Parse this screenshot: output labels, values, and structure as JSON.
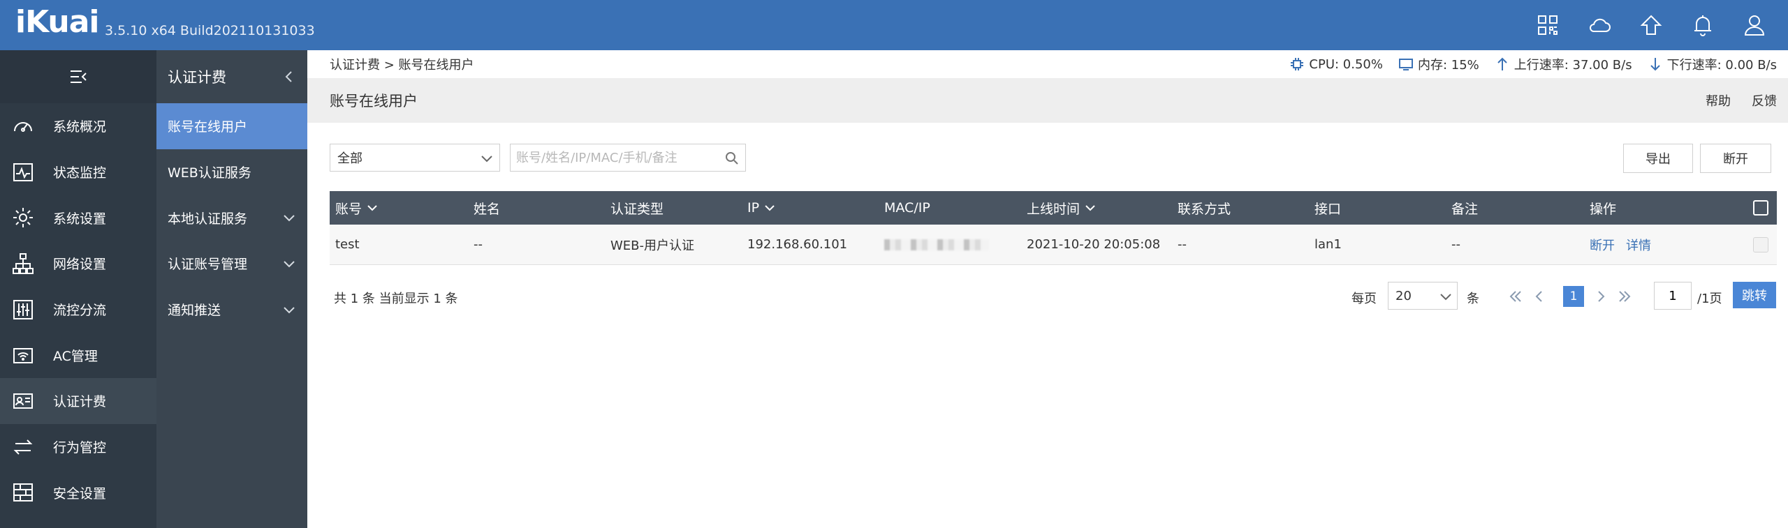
{
  "header": {
    "logo": "iKuai",
    "version": "3.5.10 x64 Build202110131033",
    "icons": [
      "apps-grid-icon",
      "cloud-icon",
      "home-arrow-icon",
      "bell-icon",
      "user-icon"
    ]
  },
  "leftnav": {
    "items": [
      {
        "label": "系统概况",
        "icon": "speedometer-icon"
      },
      {
        "label": "状态监控",
        "icon": "pulse-icon"
      },
      {
        "label": "系统设置",
        "icon": "gear-icon"
      },
      {
        "label": "网络设置",
        "icon": "network-icon"
      },
      {
        "label": "流控分流",
        "icon": "sliders-icon"
      },
      {
        "label": "AC管理",
        "icon": "wifi-icon"
      },
      {
        "label": "认证计费",
        "icon": "id-card-icon"
      },
      {
        "label": "行为管控",
        "icon": "swap-icon"
      },
      {
        "label": "安全设置",
        "icon": "firewall-icon"
      }
    ],
    "active_index": 6
  },
  "subnav": {
    "title": "认证计费",
    "items": [
      {
        "label": "账号在线用户",
        "expandable": false
      },
      {
        "label": "WEB认证服务",
        "expandable": false
      },
      {
        "label": "本地认证服务",
        "expandable": true
      },
      {
        "label": "认证账号管理",
        "expandable": true
      },
      {
        "label": "通知推送",
        "expandable": true
      }
    ]
  },
  "breadcrumb": {
    "text": "认证计费 > 账号在线用户"
  },
  "stats": {
    "cpu": "CPU: 0.50%",
    "memory": "内存: 15%",
    "upload": "上行速率: 37.00 B/s",
    "download": "下行速率: 0.00 B/s"
  },
  "page": {
    "title": "账号在线用户",
    "help": "帮助",
    "feedback": "反馈"
  },
  "toolbar": {
    "filter_value": "全部",
    "search_placeholder": "账号/姓名/IP/MAC/手机/备注",
    "export_label": "导出",
    "disconnect_label": "断开"
  },
  "table": {
    "columns": [
      "账号",
      "姓名",
      "认证类型",
      "IP",
      "MAC/IP",
      "上线时间",
      "联系方式",
      "接口",
      "备注",
      "操作"
    ],
    "rows": [
      {
        "account": "test",
        "name": "--",
        "auth_type": "WEB-用户认证",
        "ip": "192.168.60.101",
        "online_time": "2021-10-20 20:05:08",
        "contact": "--",
        "interface": "lan1",
        "remark": "--",
        "op_disconnect": "断开",
        "op_detail": "详情"
      }
    ]
  },
  "footer": {
    "total_text": "共 1 条 当前显示 1 条",
    "per_page_label": "每页",
    "per_page_value": "20",
    "per_page_unit": "条",
    "current_page": "1",
    "page_input": "1",
    "page_total": "/1页",
    "jump_label": "跳转"
  }
}
